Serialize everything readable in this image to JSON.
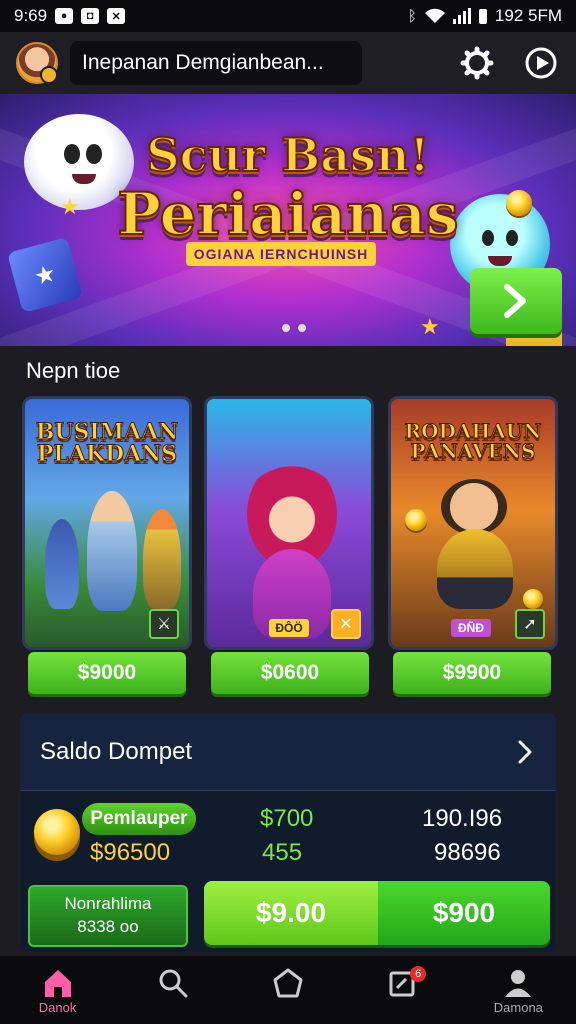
{
  "status_bar": {
    "time": "9:69",
    "right_time": "192 5FM"
  },
  "header": {
    "title": "Inepanan Demgianbean..."
  },
  "banner": {
    "title_line1": "Scur Basn!",
    "title_line2": "Periaianas",
    "subtitle": "OGIANA IERNCHUINSH"
  },
  "section": {
    "title": "Nepn tioe"
  },
  "games": [
    {
      "title": "BUSIMAAN PLAKDANS",
      "tag": "",
      "price": "$9000"
    },
    {
      "title": "",
      "tag": "ÐÔÖ",
      "price": "$0600"
    },
    {
      "title": "RODAHAUN PANAVENS",
      "tag": "ÐÑÐ",
      "price": "$9900"
    }
  ],
  "wallet": {
    "title": "Saldo Dompet",
    "badge": "Pemlauper",
    "amount_left": "$96500",
    "col2_top": "$700",
    "col2_bottom": "455",
    "col3_top": "190.I96",
    "col3_bottom": "98696",
    "left_button_line1": "Nonrahlima",
    "left_button_line2": "8338 oo",
    "big_button_left": "$9.00",
    "big_button_right": "$900"
  },
  "nav": {
    "home_label": "Danok",
    "profile_label": "Damona",
    "notif_count": "6"
  },
  "colors": {
    "accent_green": "#4fd12a",
    "wallet_bg": "#142039",
    "nav_active": "#ff5fa8"
  }
}
